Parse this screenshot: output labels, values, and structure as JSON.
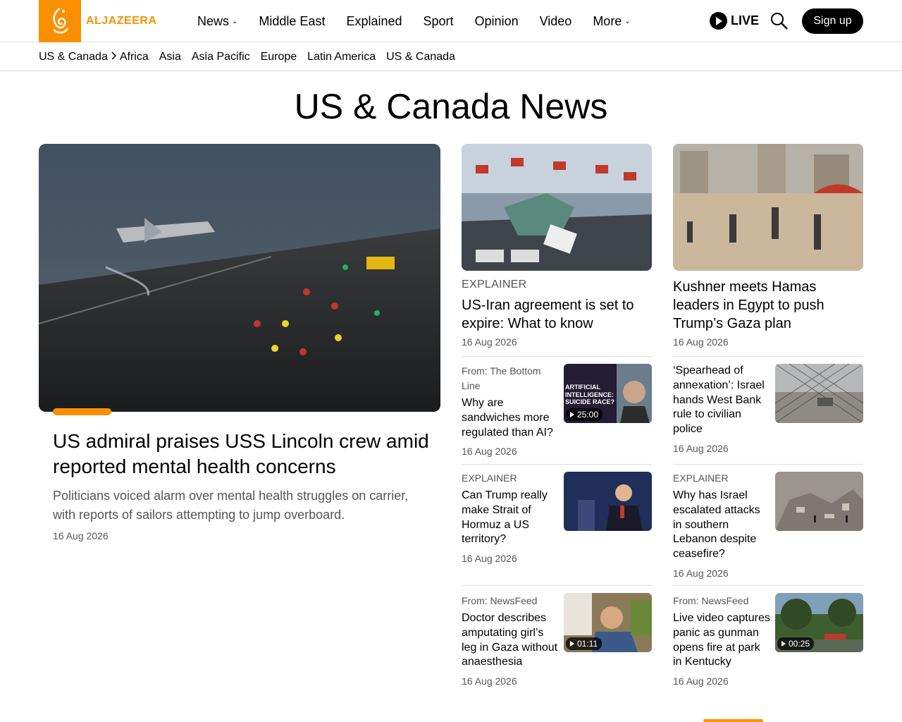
{
  "header": {
    "logo_text": "ALJAZEERA",
    "nav": [
      {
        "label": "News",
        "dropdown": true
      },
      {
        "label": "Middle East",
        "dropdown": false
      },
      {
        "label": "Explained",
        "dropdown": false
      },
      {
        "label": "Sport",
        "dropdown": false
      },
      {
        "label": "Opinion",
        "dropdown": false
      },
      {
        "label": "Video",
        "dropdown": false
      },
      {
        "label": "More",
        "dropdown": true
      }
    ],
    "live_label": "LIVE",
    "signup_label": "Sign up"
  },
  "subnav": {
    "current": "US & Canada",
    "items": [
      "Africa",
      "Asia",
      "Asia Pacific",
      "Europe",
      "Latin America",
      "US & Canada"
    ]
  },
  "page_title": "US & Canada News",
  "main_story": {
    "title": "US admiral praises USS Lincoln crew amid reported mental health concerns",
    "description": "Politicians voiced alarm over mental health struggles on carrier, with reports of sailors attempting to jump overboard.",
    "date": "16 Aug 2026"
  },
  "col2": {
    "top": {
      "tag": "EXPLAINER",
      "title": "US-Iran agreement is set to expire: What to know",
      "date": "16 Aug 2026"
    },
    "items": [
      {
        "tag": "From: The Bottom Line",
        "title": "Why are sandwiches more regulated than AI?",
        "date": "16 Aug 2026",
        "duration": "25:00",
        "thumb_text": "ARTIFICIAL INTELLIGENCE: SUICIDE RACE?"
      },
      {
        "tag": "EXPLAINER",
        "title": "Can Trump really make Strait of Hormuz a US territory?",
        "date": "16 Aug 2026",
        "duration": ""
      },
      {
        "tag": "From: NewsFeed",
        "title": "Doctor describes amputating girl’s leg in Gaza without anaesthesia",
        "date": "16 Aug 2026",
        "duration": "01:11"
      }
    ]
  },
  "col3": {
    "top": {
      "title": "Kushner meets Hamas leaders in Egypt to push Trump’s Gaza plan",
      "date": "16 Aug 2026"
    },
    "items": [
      {
        "tag": "",
        "title": "‘Spearhead of annexation’: Israel hands West Bank rule to civilian police",
        "date": "16 Aug 2026",
        "duration": ""
      },
      {
        "tag": "EXPLAINER",
        "title": "Why has Israel escalated attacks in southern Lebanon despite ceasefire?",
        "date": "16 Aug 2026",
        "duration": ""
      },
      {
        "tag": "From: NewsFeed",
        "title": "Live video captures panic as gunman opens fire at park in Kentucky",
        "date": "16 Aug 2026",
        "duration": "00:25"
      }
    ]
  },
  "colors": {
    "brand": "#fa9000",
    "text": "#000000",
    "muted": "#555555"
  }
}
